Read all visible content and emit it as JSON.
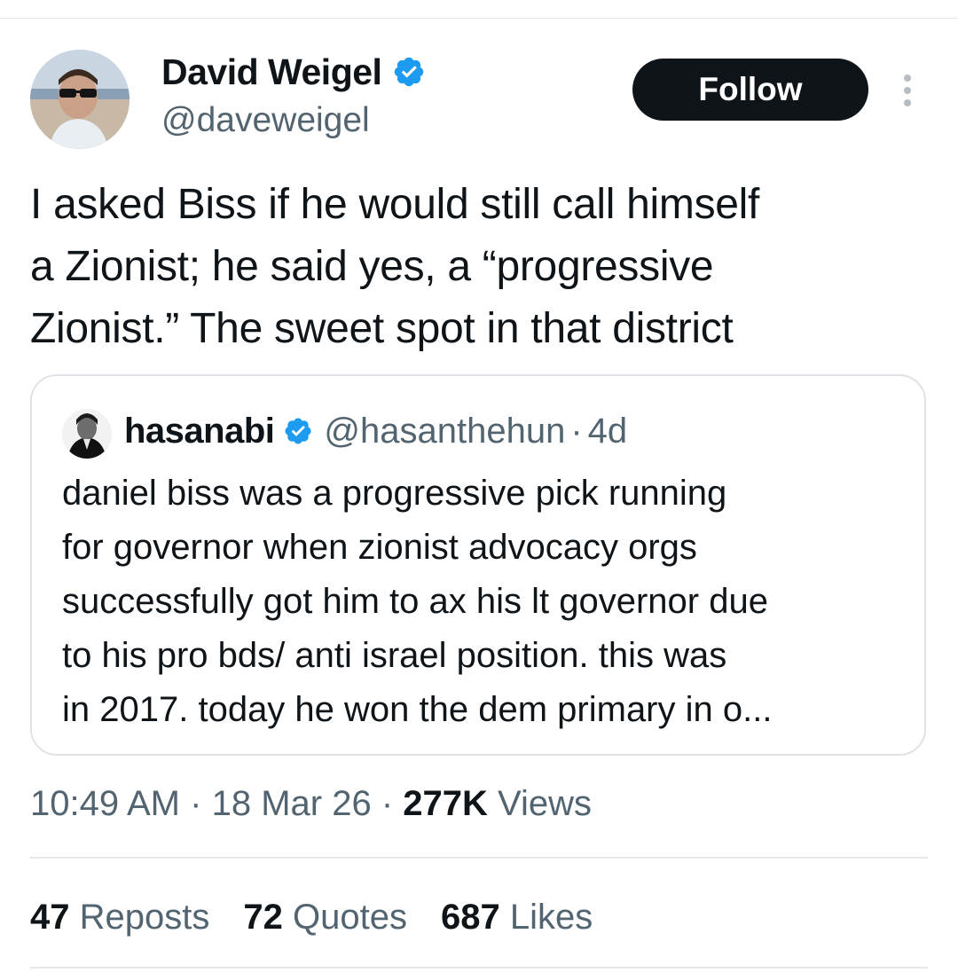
{
  "author": {
    "name": "David Weigel",
    "handle": "@daveweigel",
    "verified_color": "#1d9bf0"
  },
  "follow_button": {
    "label": "Follow"
  },
  "more_icon": "more-vertical-icon",
  "tweet": {
    "lines": [
      "I asked Biss if he would still call himself",
      "a Zionist; he said yes, a “progressive",
      "Zionist.” The sweet spot in that district"
    ]
  },
  "quote": {
    "name": "hasanabi",
    "handle": "@hasanthehun",
    "separator": "·",
    "time": "4d",
    "lines": [
      "daniel biss was a progressive pick running",
      "for governor when zionist advocacy orgs",
      "successfully got him to ax his lt governor due",
      "to his pro bds/ anti israel position. this was",
      "in 2017. today he won the dem primary in o..."
    ]
  },
  "meta": {
    "time": "10:49 AM",
    "sep1": "·",
    "date": "18 Mar 26",
    "sep2": "·",
    "views_count": "277K",
    "views_label": "Views"
  },
  "stats": {
    "reposts_count": "47",
    "reposts_label": "Reposts",
    "quotes_count": "72",
    "quotes_label": "Quotes",
    "likes_count": "687",
    "likes_label": "Likes"
  }
}
